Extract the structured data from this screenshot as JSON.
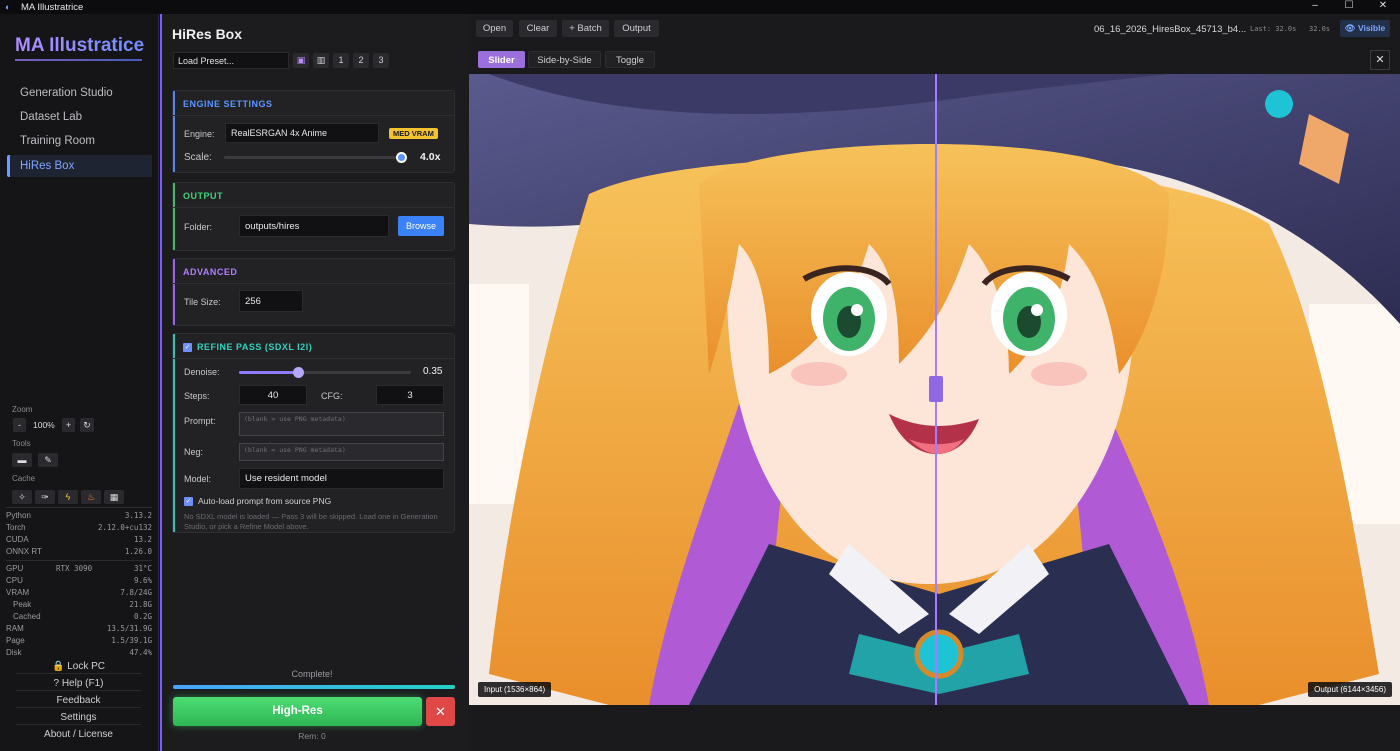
{
  "window": {
    "title": "MA Illustratrice",
    "controls": [
      "–",
      "☐",
      "✕"
    ]
  },
  "sidebar": {
    "brand": "MA Illustratice",
    "nav": [
      {
        "label": "Generation Studio"
      },
      {
        "label": "Dataset Lab"
      },
      {
        "label": "Training Room"
      },
      {
        "label": "HiRes Box",
        "active": true
      }
    ],
    "zoom": {
      "label": "Zoom",
      "minus": "-",
      "value": "100%",
      "plus": "+",
      "reset": "↻"
    },
    "tools_label": "Tools",
    "cache_label": "Cache",
    "versions": [
      {
        "k": "Python",
        "v": "3.13.2"
      },
      {
        "k": "Torch",
        "v": "2.12.0+cu132"
      },
      {
        "k": "CUDA",
        "v": "13.2"
      },
      {
        "k": "ONNX RT",
        "v": "1.26.0"
      }
    ],
    "gpu": {
      "k": "GPU",
      "name": "RTX 3090",
      "v": "31°C"
    },
    "resources": [
      {
        "k": "CPU",
        "v": "9.6%"
      },
      {
        "k": "VRAM",
        "v": "7.8/24G"
      },
      {
        "k": "Peak",
        "v": "21.8G"
      },
      {
        "k": "Cached",
        "v": "0.2G"
      },
      {
        "k": "RAM",
        "v": "13.5/31.9G"
      },
      {
        "k": "Page",
        "v": "1.5/39.1G"
      },
      {
        "k": "Disk",
        "v": "47.4%"
      }
    ],
    "buttons": {
      "lock": "🔒 Lock PC",
      "help": "? Help (F1)",
      "feedback": "Feedback",
      "settings": "Settings",
      "about": "About / License"
    }
  },
  "panel": {
    "title": "HiRes Box",
    "preset": {
      "value": "Load Preset...",
      "slots": [
        "1",
        "2",
        "3"
      ]
    },
    "engine": {
      "header": "ENGINE SETTINGS",
      "engine_label": "Engine:",
      "engine_value": "RealESRGAN 4x Anime",
      "badge": "MED VRAM",
      "scale_label": "Scale:",
      "scale_value": "4.0x",
      "scale_fraction": 1.0
    },
    "output": {
      "header": "OUTPUT",
      "folder_label": "Folder:",
      "folder_value": "outputs/hires",
      "browse": "Browse"
    },
    "advanced": {
      "header": "ADVANCED",
      "tile_label": "Tile Size:",
      "tile_value": "256"
    },
    "refine": {
      "header": "REFINE PASS (SDXL I2I)",
      "denoise_label": "Denoise:",
      "denoise_value": "0.35",
      "denoise_fraction": 0.35,
      "steps_label": "Steps:",
      "steps_value": "40",
      "cfg_label": "CFG:",
      "cfg_value": "3",
      "prompt_label": "Prompt:",
      "prompt_placeholder": "(blank = use PNG metadata)",
      "neg_label": "Neg:",
      "neg_placeholder": "(blank = use PNG metadata)",
      "model_label": "Model:",
      "model_value": "Use resident model",
      "autoload_label": "Auto-load prompt from source PNG",
      "note": "No SDXL model is loaded — Pass 3 will be skipped. Load one in Generation Studio, or pick a Refine Model above."
    },
    "progress": {
      "status": "Complete!",
      "fraction": 1.0,
      "remaining": "Rem: 0"
    },
    "run_button": "High-Res",
    "cancel_button": "✕"
  },
  "viewer": {
    "toolbar": {
      "open": "Open",
      "clear": "Clear",
      "batch": "+ Batch",
      "output": "Output"
    },
    "filename": "06_16_2026_HiresBox_45713_b4...",
    "last": "Last: 32.0s",
    "time": "32.0s",
    "visible": "👁 Visible",
    "modes": {
      "slider": "Slider",
      "side": "Side-by-Side",
      "toggle": "Toggle"
    },
    "close": "✕",
    "input_tag": "Input (1536×864)",
    "output_tag": "Output (6144×3456)",
    "slider_fraction": 0.5
  }
}
